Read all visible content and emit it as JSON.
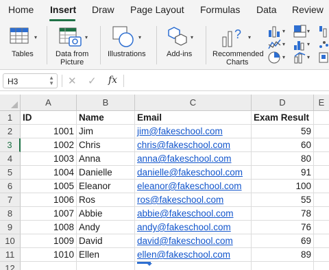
{
  "ribbon_tabs": [
    "Home",
    "Insert",
    "Draw",
    "Page Layout",
    "Formulas",
    "Data",
    "Review"
  ],
  "active_tab": "Insert",
  "ribbon_groups": {
    "tables_label": "Tables",
    "picture_label_line1": "Data from",
    "picture_label_line2": "Picture",
    "illustrations_label": "Illustrations",
    "addins_label": "Add-ins",
    "charts_label_line1": "Recommended",
    "charts_label_line2": "Charts"
  },
  "formula_bar": {
    "name_box": "H3",
    "fx_label": "fx",
    "formula_value": ""
  },
  "columns": [
    "A",
    "B",
    "C",
    "D",
    "E"
  ],
  "row_numbers": [
    "1",
    "2",
    "3",
    "4",
    "5",
    "6",
    "7",
    "8",
    "9",
    "10",
    "11",
    "12"
  ],
  "selected_row": "3",
  "headers": {
    "id": "ID",
    "name": "Name",
    "email": "Email",
    "exam": "Exam Result"
  },
  "rows": [
    {
      "id": "1001",
      "name": "Jim",
      "email": "jim@fakeschool.com",
      "exam": "59"
    },
    {
      "id": "1002",
      "name": "Chris",
      "email": "chris@fakeschool.com",
      "exam": "60"
    },
    {
      "id": "1003",
      "name": "Anna",
      "email": "anna@fakeschool.com",
      "exam": "80"
    },
    {
      "id": "1004",
      "name": "Danielle",
      "email": "danielle@fakeschool.com",
      "exam": "91"
    },
    {
      "id": "1005",
      "name": "Eleanor",
      "email": "eleanor@fakeschool.com",
      "exam": "100"
    },
    {
      "id": "1006",
      "name": "Ros",
      "email": "ros@fakeschool.com",
      "exam": "55"
    },
    {
      "id": "1007",
      "name": "Abbie",
      "email": "abbie@fakeschool.com",
      "exam": "78"
    },
    {
      "id": "1008",
      "name": "Andy",
      "email": "andy@fakeschool.com",
      "exam": "76"
    },
    {
      "id": "1009",
      "name": "David",
      "email": "david@fakeschool.com",
      "exam": "69"
    },
    {
      "id": "1010",
      "name": "Ellen",
      "email": "ellen@fakeschool.com",
      "exam": "89"
    }
  ],
  "colors": {
    "accent_green": "#1e7145",
    "link_blue": "#1155cc",
    "icon_blue": "#2e6fd1"
  }
}
